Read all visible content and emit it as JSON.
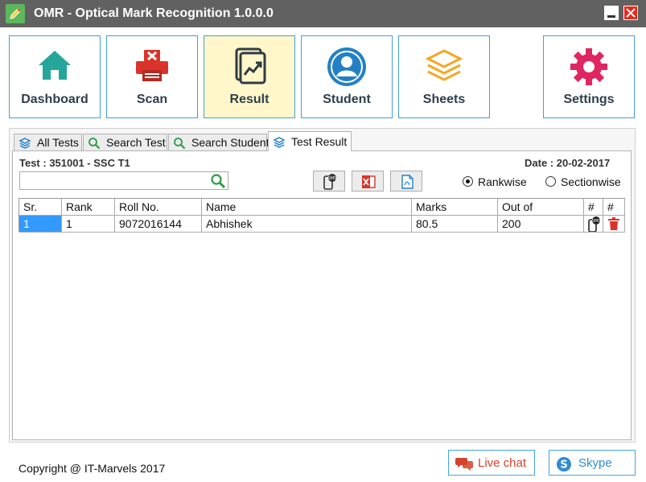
{
  "window": {
    "title": "OMR - Optical Mark Recognition 1.0.0.0",
    "app_icon": "pencil-icon",
    "minimize_icon": "minimize-icon",
    "close_icon": "close-icon"
  },
  "nav": {
    "active": "Result",
    "items": [
      {
        "label": "Dashboard",
        "icon": "home-icon",
        "color": "#26a69a"
      },
      {
        "label": "Scan",
        "icon": "printer-icon",
        "color": "#d9342b"
      },
      {
        "label": "Result",
        "icon": "chart-document-icon",
        "color": "#2d3b45"
      },
      {
        "label": "Student",
        "icon": "user-icon",
        "color": "#2380c5"
      },
      {
        "label": "Sheets",
        "icon": "layers-icon",
        "color": "#f5a623"
      },
      {
        "label": "Settings",
        "icon": "gear-icon",
        "color": "#e02660"
      }
    ]
  },
  "tabs": {
    "active": "Test Result",
    "items": [
      {
        "label": "All Tests",
        "icon": "layers-icon"
      },
      {
        "label": "Search Test",
        "icon": "search-icon"
      },
      {
        "label": "Search Student",
        "icon": "search-icon"
      },
      {
        "label": "Test Result",
        "icon": "layers-icon"
      }
    ]
  },
  "result": {
    "test_label": "Test : 351001 - SSC T1",
    "date_label": "Date : 20-02-2017",
    "search": {
      "value": "",
      "placeholder": ""
    },
    "tools": [
      {
        "icon": "sms-phone-icon"
      },
      {
        "icon": "excel-icon"
      },
      {
        "icon": "pdf-icon"
      }
    ],
    "sort_options": [
      {
        "label": "Rankwise",
        "selected": true
      },
      {
        "label": "Sectionwise",
        "selected": false
      }
    ],
    "table": {
      "columns": [
        "Sr.",
        "Rank",
        "Roll No.",
        "Name",
        "Marks",
        "Out of",
        "#",
        "#"
      ],
      "rows": [
        {
          "sr": "1",
          "rank": "1",
          "roll_no": "9072016144",
          "name": "Abhishek",
          "marks": "80.5",
          "out_of": "200",
          "action_1": "sms-icon",
          "action_2": "trash-icon"
        }
      ]
    }
  },
  "footer": {
    "copyright": "Copyright @ IT-Marvels 2017",
    "live_chat": "Live chat",
    "skype": "Skype",
    "live_chat_icon": "chat-bubbles-icon",
    "skype_icon": "skype-icon"
  },
  "colors": {
    "titlebar": "#616161",
    "accent_border": "#3fa0d6",
    "active_nav_bg": "#fff7c9",
    "selection": "#3399ff",
    "close_button": "#e8291c"
  }
}
